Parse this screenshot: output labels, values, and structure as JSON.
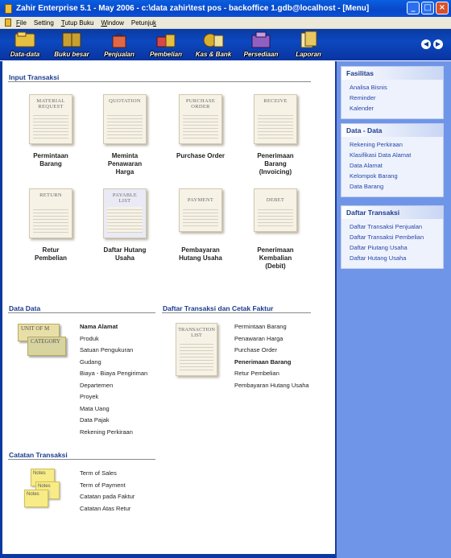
{
  "window": {
    "title": "Zahir Enterprise 5.1 - May 2006 - c:\\data zahir\\test pos - backoffice 1.gdb@localhost - [Menu]",
    "buttons": [
      "_",
      "□",
      "×"
    ]
  },
  "menubar": [
    {
      "pre": "",
      "u": "F",
      "post": "ile"
    },
    {
      "pre": "Setting",
      "u": "",
      "post": ""
    },
    {
      "pre": "",
      "u": "T",
      "post": "utup Buku"
    },
    {
      "pre": "",
      "u": "W",
      "post": "indow"
    },
    {
      "pre": "Petunju",
      "u": "k",
      "post": ""
    }
  ],
  "toolbar": {
    "items": [
      {
        "label": "Data-data",
        "color": "#e8c040"
      },
      {
        "label": "Buku besar",
        "color": "#c8a030"
      },
      {
        "label": "Penjualan",
        "color": "#e06848"
      },
      {
        "label": "Pembelian",
        "color": "#d84848"
      },
      {
        "label": "Kas & Bank",
        "color": "#d8b030"
      },
      {
        "label": "Persediaan",
        "color": "#9060c0"
      },
      {
        "label": "Laporan",
        "color": "#e8c860"
      }
    ],
    "prev": "◀",
    "next": "▶"
  },
  "input_transaksi": {
    "title": "Input Transaksi",
    "docs": [
      {
        "head1": "MATERIAL",
        "head2": "REQUEST",
        "l1": "Permintaan",
        "l2": "Barang",
        "l3": ""
      },
      {
        "head1": "QUOTATION",
        "head2": "",
        "l1": "Meminta",
        "l2": "Penawaran",
        "l3": "Harga"
      },
      {
        "head1": "PURCHASE",
        "head2": "ORDER",
        "l1": "Purchase Order",
        "l2": "",
        "l3": ""
      },
      {
        "head1": "RECEIVE",
        "head2": "",
        "l1": "Penerimaan",
        "l2": "Barang",
        "l3": "(Invoicing)"
      },
      {
        "head1": "RETURN",
        "head2": "",
        "l1": "Retur",
        "l2": "Pembelian",
        "l3": ""
      },
      {
        "head1": "PAYABLE",
        "head2": "LIST",
        "l1": "Daftar Hutang",
        "l2": "Usaha",
        "l3": ""
      },
      {
        "head1": "PAYMENT",
        "head2": "",
        "l1": "Pembayaran",
        "l2": "Hutang Usaha",
        "l3": ""
      },
      {
        "head1": "DEBET",
        "head2": "",
        "l1": "Penerimaan",
        "l2": "Kembalian",
        "l3": "(Debit)"
      }
    ]
  },
  "data_data": {
    "title": "Data Data",
    "icon_text": [
      "UNIT OF M",
      "CATEGORY"
    ],
    "items": [
      "Nama Alamat",
      "Produk",
      "Satuan Pengukuran",
      "Gudang",
      "Biaya - Biaya Pengiriman",
      "Departemen",
      "Proyek",
      "Mata Uang",
      "Data Pajak",
      "Rekening Perkiraan"
    ]
  },
  "daftar_cetak": {
    "title": "Daftar Transaksi dan Cetak Faktur",
    "icon_text": [
      "TRANSACTION",
      "LIST"
    ],
    "items": [
      "Permintaan Barang",
      "Penawaran Harga",
      "Purchase Order",
      "Penerimaan Barang",
      "Retur Pembelian",
      "Pembayaran Hutang Usaha"
    ]
  },
  "catatan": {
    "title": "Catatan Transaksi",
    "notes": [
      "Notes",
      "Notes",
      "Notes"
    ],
    "items": [
      "Term of Sales",
      "Term of Payment",
      "Catatan pada Faktur",
      "Catatan Atas Retur"
    ]
  },
  "sidebar": {
    "fasilitas": {
      "title": "Fasilitas",
      "items": [
        "Analisa Bisnis",
        "Reminder",
        "Kalender"
      ]
    },
    "data": {
      "title": "Data - Data",
      "items": [
        "Rekening Perkiraan",
        "Klasifikasi Data Alamat",
        "Data Alamat",
        "Kelompok Barang",
        "Data Barang"
      ]
    },
    "daftar": {
      "title": "Daftar Transaksi",
      "items": [
        "Daftar Transaksi Penjualan",
        "Daftar Transaksi Pembelian",
        "Daftar Piutang Usaha",
        "Daftar Hutang Usaha"
      ]
    }
  }
}
